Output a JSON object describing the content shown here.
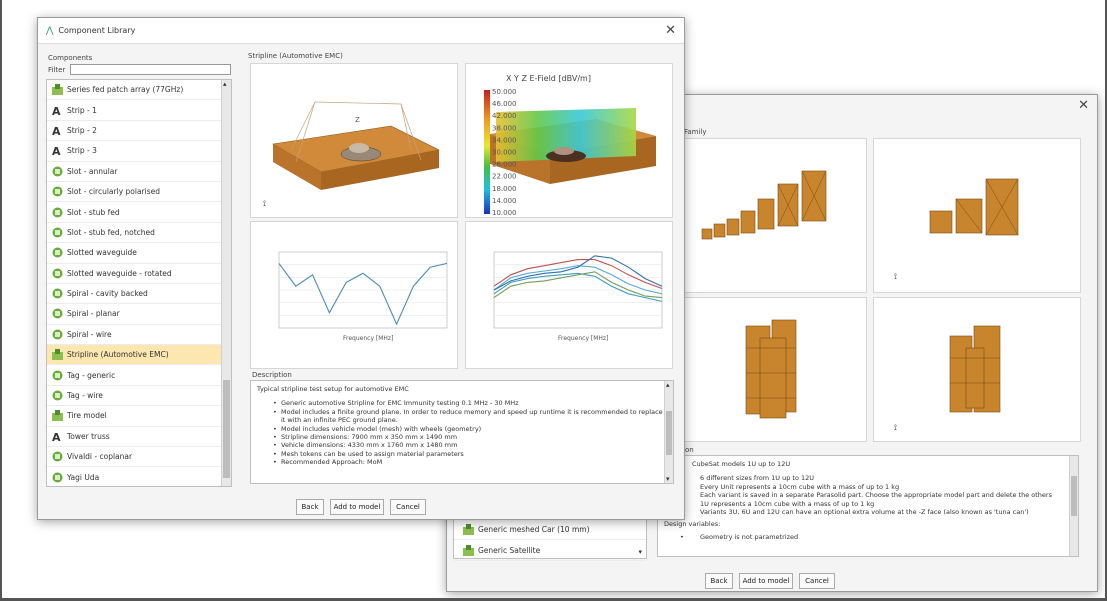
{
  "back_window": {
    "section_label": "Family",
    "description_label": "ation",
    "description_title": "CubeSat models 1U up to 12U",
    "description_bullets": [
      "6 different sizes from 1U up to 12U",
      "Every Unit represents a 10cm cube with a mass of up to 1 kg",
      "Each variant is saved in a separate Parasolid part. Choose the appropriate model part and delete the others",
      "1U represents a 10cm cube with a mass of up to 1 kg",
      "Variants 3U, 6U and 12U can have an optional extra volume at the -Z face (also known as 'tuna can')"
    ],
    "design_variables_label": "Design variables:",
    "design_variables_bullet": "Geometry is not parametrized",
    "list_items": [
      "Generic meshed Car (10 mm)",
      "Generic Satellite"
    ],
    "buttons": {
      "back": "Back",
      "add": "Add to model",
      "cancel": "Cancel"
    }
  },
  "front_window": {
    "title": "Component Library",
    "components_label": "Components",
    "filter_label": "Filter",
    "filter_value": "",
    "preview_label": "Stripline (Automotive EMC)",
    "efield_title": "X Y Z E-Field [dBV/m]",
    "efield_ticks": [
      "50.000",
      "46.000",
      "42.000",
      "38.000",
      "34.000",
      "30.000",
      "26.000",
      "22.000",
      "18.000",
      "14.000",
      "10.000"
    ],
    "colors": {
      "accent_selected": "#fde7b0",
      "slab": "#c47a2a",
      "green_icon": "#6aaa3a"
    },
    "items": [
      {
        "label": "Series fed patch array (77GHz)",
        "icon": "patch-icon"
      },
      {
        "label": "Strip - 1",
        "icon": "wire-a-icon"
      },
      {
        "label": "Strip - 2",
        "icon": "wire-a-icon"
      },
      {
        "label": "Strip - 3",
        "icon": "wire-a-icon"
      },
      {
        "label": "Slot - annular",
        "icon": "cube-icon"
      },
      {
        "label": "Slot - circularly polarised",
        "icon": "cube-icon"
      },
      {
        "label": "Slot - stub fed",
        "icon": "cube-icon"
      },
      {
        "label": "Slot - stub fed, notched",
        "icon": "cube-icon"
      },
      {
        "label": "Slotted waveguide",
        "icon": "cube-icon"
      },
      {
        "label": "Slotted waveguide - rotated",
        "icon": "cube-icon"
      },
      {
        "label": "Spiral - cavity backed",
        "icon": "cube-icon"
      },
      {
        "label": "Spiral - planar",
        "icon": "cube-icon"
      },
      {
        "label": "Spiral - wire",
        "icon": "cube-icon"
      },
      {
        "label": "Stripline (Automotive EMC)",
        "icon": "patch-icon",
        "selected": true
      },
      {
        "label": "Tag - generic",
        "icon": "cube-icon"
      },
      {
        "label": "Tag - wire",
        "icon": "cube-icon"
      },
      {
        "label": "Tire model",
        "icon": "patch-icon"
      },
      {
        "label": "Tower truss",
        "icon": "wire-a-icon"
      },
      {
        "label": "Vivaldi - coplanar",
        "icon": "cube-icon"
      },
      {
        "label": "Yagi Uda",
        "icon": "cube-icon"
      }
    ],
    "description_label": "Description",
    "description_title": "Typical stripline test setup for automotive EMC",
    "description_bullets": [
      "Generic automotive Stripline for EMC Immunity testing 0.1 MHz - 30 MHz",
      "Model includes a finite ground plane. In order to reduce memory and speed up runtime it is recommended to replace it with an infinite PEC ground plane.",
      "Model includes vehicle model (mesh) with wheels (geometry)",
      "Stripline dimensions: 7900 mm x 350 mm x 1490 mm",
      "Vehicle dimensions: 4330 mm x 1760 mm x 1480 mm",
      "Mesh tokens can be used to assign material parameters",
      "Recommended Approach: MoM"
    ],
    "buttons": {
      "back": "Back",
      "add": "Add to model",
      "cancel": "Cancel"
    }
  },
  "chart_data": [
    {
      "type": "line",
      "title": "",
      "xlabel": "Frequency [MHz]",
      "ylabel": "",
      "xlim": [
        0,
        30
      ],
      "series": [
        {
          "x": [
            0,
            3,
            6,
            9,
            12,
            15,
            18,
            21,
            24,
            27,
            30
          ],
          "values": [
            0.85,
            0.55,
            0.7,
            0.2,
            0.6,
            0.72,
            0.55,
            0.05,
            0.55,
            0.8,
            0.85
          ]
        }
      ]
    },
    {
      "type": "line",
      "title": "",
      "xlabel": "Frequency [MHz]",
      "ylabel": "",
      "xlim": [
        0,
        30
      ],
      "series": [
        {
          "x": [
            0,
            3,
            6,
            9,
            12,
            15,
            18,
            21,
            24,
            27,
            30
          ],
          "values": [
            0.45,
            0.6,
            0.65,
            0.68,
            0.7,
            0.72,
            0.68,
            0.55,
            0.45,
            0.4,
            0.35
          ]
        },
        {
          "x": [
            0,
            3,
            6,
            9,
            12,
            15,
            18,
            21,
            24,
            27,
            30
          ],
          "values": [
            0.5,
            0.66,
            0.72,
            0.75,
            0.78,
            0.82,
            0.8,
            0.7,
            0.58,
            0.5,
            0.45
          ]
        },
        {
          "x": [
            0,
            3,
            6,
            9,
            12,
            15,
            18,
            21,
            24,
            27,
            30
          ],
          "values": [
            0.55,
            0.7,
            0.78,
            0.82,
            0.86,
            0.9,
            0.9,
            0.82,
            0.7,
            0.6,
            0.52
          ]
        },
        {
          "x": [
            0,
            3,
            6,
            9,
            12,
            15,
            18,
            21,
            24,
            27,
            30
          ],
          "values": [
            0.4,
            0.55,
            0.6,
            0.62,
            0.66,
            0.7,
            0.74,
            0.6,
            0.5,
            0.42,
            0.4
          ]
        },
        {
          "x": [
            0,
            3,
            6,
            9,
            12,
            15,
            18,
            21,
            24,
            27,
            30
          ],
          "values": [
            0.5,
            0.62,
            0.68,
            0.72,
            0.74,
            0.8,
            0.95,
            0.92,
            0.8,
            0.65,
            0.55
          ]
        }
      ]
    }
  ]
}
